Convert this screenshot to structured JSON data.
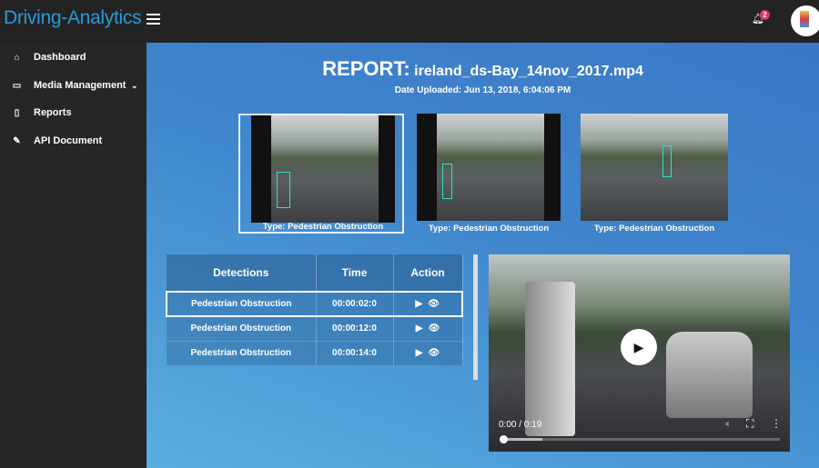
{
  "header": {
    "brand": "Driving-Analytics",
    "notification_count": "2"
  },
  "sidebar": {
    "items": [
      {
        "label": "Dashboard",
        "icon": "home-icon"
      },
      {
        "label": "Media Management",
        "icon": "monitor-icon"
      },
      {
        "label": "Reports",
        "icon": "document-icon"
      },
      {
        "label": "API Document",
        "icon": "pencil-icon"
      }
    ]
  },
  "report": {
    "prefix": "REPORT:",
    "filename": "ireland_ds-Bay_14nov_2017.mp4",
    "date": "Date Uploaded: Jun 13, 2018, 6:04:06 PM"
  },
  "thumbnails": [
    {
      "caption": "Type: Pedestrian Obstruction"
    },
    {
      "caption": "Type: Pedestrian Obstruction"
    },
    {
      "caption": "Type: Pedestrian Obstruction"
    }
  ],
  "table": {
    "headers": [
      "Detections",
      "Time",
      "Action"
    ],
    "rows": [
      {
        "detection": "Pedestrian Obstruction",
        "time": "00:00:02:0"
      },
      {
        "detection": "Pedestrian Obstruction",
        "time": "00:00:12:0"
      },
      {
        "detection": "Pedestrian Obstruction",
        "time": "00:00:14:0"
      }
    ]
  },
  "video": {
    "time": "0:00 / 0:19",
    "progress": 0,
    "buffered": 0.14
  }
}
